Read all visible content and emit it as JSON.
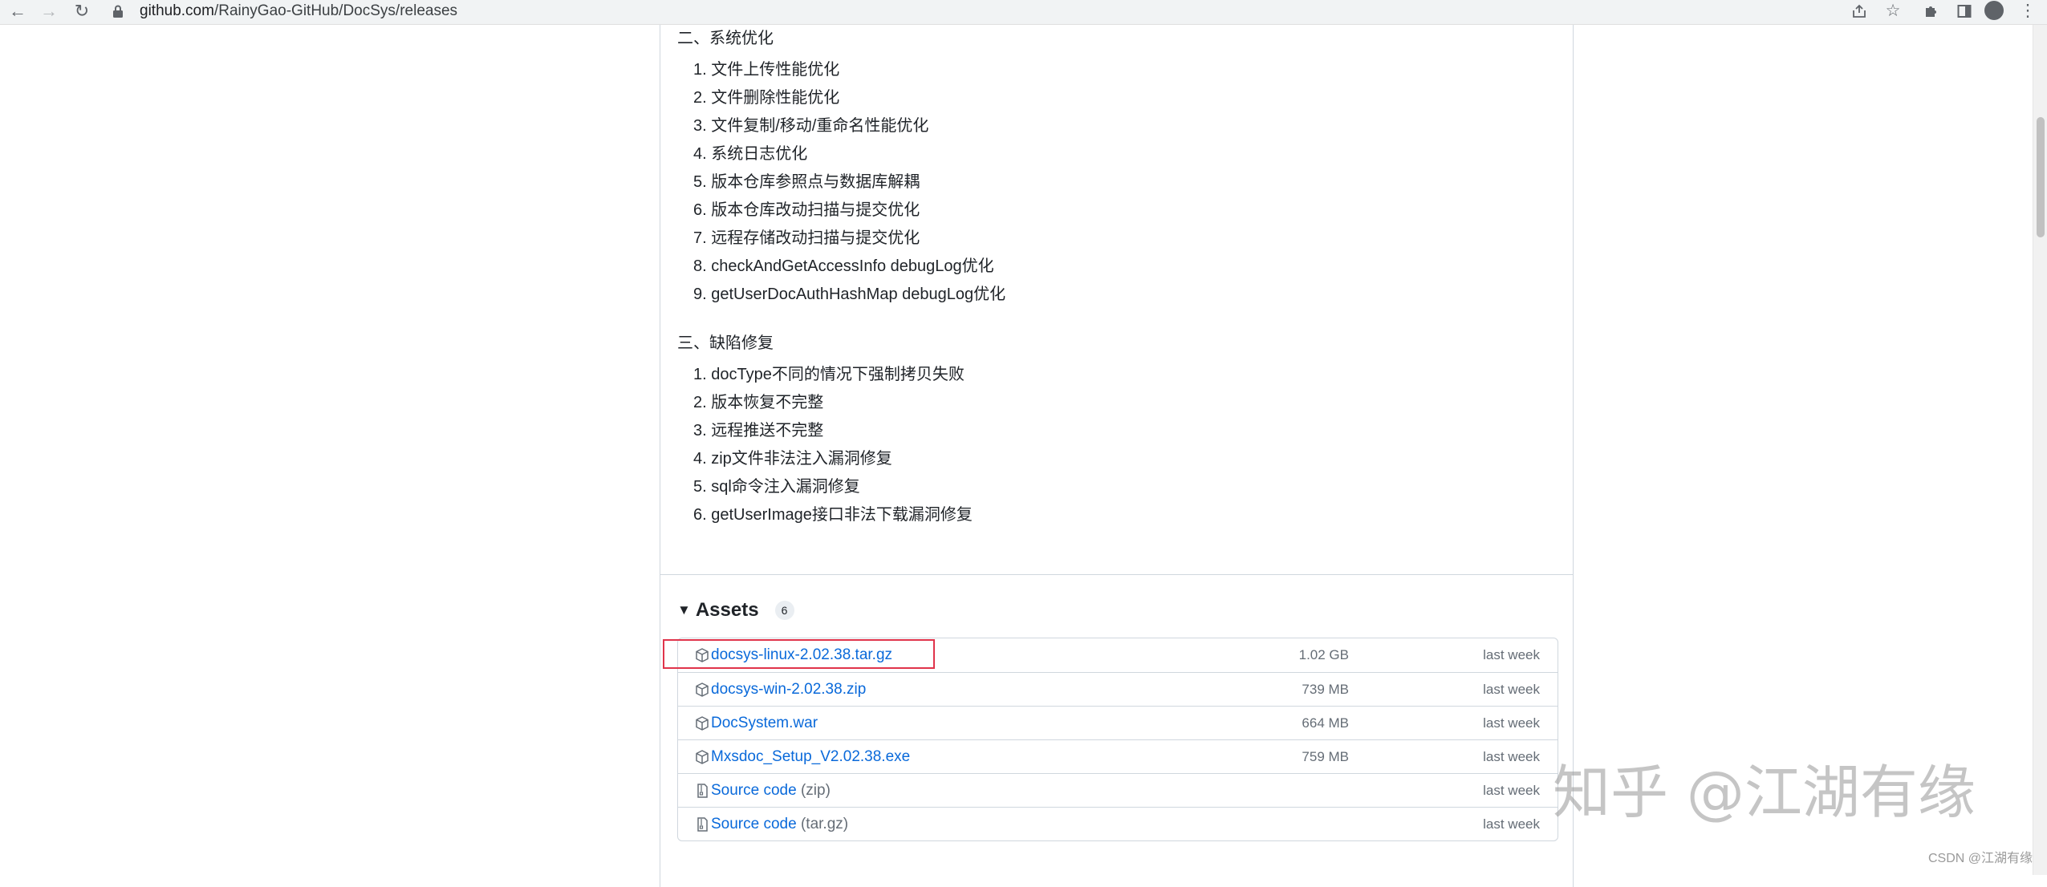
{
  "browser": {
    "url_domain": "github.com",
    "url_path": "/RainyGao-GitHub/DocSys/releases",
    "icons": {
      "back": "arrow-left-icon",
      "forward": "arrow-right-icon",
      "reload": "reload-icon",
      "lock": "lock-icon",
      "share": "share-icon",
      "bookmark": "star-icon",
      "extensions": "puzzle-icon",
      "side_panel": "side-panel-icon",
      "profile": "profile-icon",
      "menu": "kebab-menu-icon"
    }
  },
  "release_notes": {
    "section2": {
      "heading": "二、系统优化",
      "items": [
        "1. 文件上传性能优化",
        "2. 文件删除性能优化",
        "3. 文件复制/移动/重命名性能优化",
        "4. 系统日志优化",
        "5. 版本仓库参照点与数据库解耦",
        "6. 版本仓库改动扫描与提交优化",
        "7. 远程存储改动扫描与提交优化",
        "8. checkAndGetAccessInfo debugLog优化",
        "9. getUserDocAuthHashMap debugLog优化"
      ]
    },
    "section3": {
      "heading": "三、缺陷修复",
      "items": [
        "1. docType不同的情况下强制拷贝失败",
        "2. 版本恢复不完整",
        "3. 远程推送不完整",
        "4. zip文件非法注入漏洞修复",
        "5. sql命令注入漏洞修复",
        "6. getUserImage接口非法下载漏洞修复"
      ]
    }
  },
  "assets": {
    "title": "Assets",
    "count": "6",
    "rows": [
      {
        "name": "docsys-linux-2.02.38.tar.gz",
        "note": "",
        "size": "1.02 GB",
        "date": "last week",
        "icon": "package-icon"
      },
      {
        "name": "docsys-win-2.02.38.zip",
        "note": "",
        "size": "739 MB",
        "date": "last week",
        "icon": "package-icon"
      },
      {
        "name": "DocSystem.war",
        "note": "",
        "size": "664 MB",
        "date": "last week",
        "icon": "package-icon"
      },
      {
        "name": "Mxsdoc_Setup_V2.02.38.exe",
        "note": "",
        "size": "759 MB",
        "date": "last week",
        "icon": "package-icon"
      },
      {
        "name": "Source code",
        "note": " (zip)",
        "size": "",
        "date": "last week",
        "icon": "file-zip-icon"
      },
      {
        "name": "Source code",
        "note": " (tar.gz)",
        "size": "",
        "date": "last week",
        "icon": "file-zip-icon"
      }
    ]
  },
  "watermark": {
    "text": "知乎 @江湖有缘",
    "csdn": "CSDN @江湖有缘"
  },
  "colors": {
    "link": "#0969da",
    "muted": "#656d76",
    "border": "#d0d7de",
    "highlight": "#e0344b",
    "toolbar": "#f1f3f4"
  }
}
